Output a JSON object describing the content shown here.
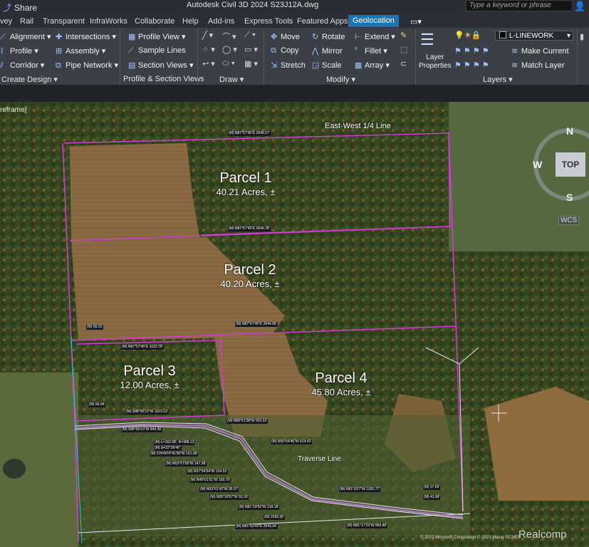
{
  "titlebar": {
    "share_label": "Share",
    "app_title": "Autodesk Civil 3D 2024    S23J12A.dwg",
    "search_placeholder": "Type a keyword or phrase"
  },
  "tabs": [
    "vey",
    "Rail",
    "Transparent",
    "InfraWorks",
    "Collaborate",
    "Help",
    "Add-ins",
    "Express Tools",
    "Featured Apps",
    "Geolocation"
  ],
  "active_tab": "Geolocation",
  "ribbon": {
    "create_design": {
      "items": [
        "Alignment",
        "Profile",
        "Corridor",
        "Intersections",
        "Assembly",
        "Pipe Network"
      ],
      "label": "Create Design"
    },
    "profile_section": {
      "items": [
        "Profile View",
        "Sample Lines",
        "Section Views"
      ],
      "label": "Profile & Section Views"
    },
    "draw": {
      "label": "Draw"
    },
    "modify": {
      "items": [
        "Move",
        "Copy",
        "Stretch",
        "Rotate",
        "Mirror",
        "Scale",
        "Extend",
        "Fillet",
        "Array"
      ],
      "label": "Modify"
    },
    "layers": {
      "layer_properties": "Layer\nProperties",
      "current_layer": "L-LINEWORK",
      "make_current": "Make Current",
      "match_layer": "Match Layer",
      "label": "Layers"
    }
  },
  "viewport": {
    "view_label": "reframe]",
    "compass": {
      "n": "N",
      "w": "W",
      "s": "S",
      "top": "TOP",
      "wcs": "WCS"
    },
    "parcels": [
      {
        "name": "Parcel 1",
        "acres": "40.21 Acres, ±"
      },
      {
        "name": "Parcel 2",
        "acres": "40.20 Acres, ±"
      },
      {
        "name": "Parcel 3",
        "acres": "12.00 Acres, ±"
      },
      {
        "name": "Parcel 4",
        "acres": "45.80 Acres, ±"
      }
    ],
    "labels": {
      "quarter_line": "East-West 1/4 Line",
      "traverse": "Traverse Line"
    },
    "bearings": [
      "(M) N87°57'45\"E 2645.57'",
      "(M) N87°57'45\"E 2646.78'",
      "(M) N87°57'45\"E 2644.99'",
      "(M) N87°57'45\"E 1022.78'",
      "(M) S88°50'23\"W 1023.19'",
      "(M) S88°50'23\"W 844.36'",
      "(M) N89°51'38\"W 952.62'",
      "(M) N50°54'46\"W 624.43'",
      "(M) N81°03'7\"W 1252.77'",
      "(M) N81°17'23\"W 866.80'",
      "(M) N81°52'43\"E 2643.34'",
      "(M) 2599.36'",
      "(M) 66.01'",
      "(M) 66.04'",
      "(M) 37.65'",
      "(M) 43.99'",
      "(M) L=162.68', R=388.13",
      "(M) Δ=22°26'46\"",
      "(M) CH=N74°41'56\"W 151.08'",
      "(M) N53°57'56\"W 147.38'",
      "(M) N37°54'54\"W 124.51'",
      "(M) N49°01'51\"W 100.70'",
      "(M) N53°01'42\"W 95.57'",
      "(M) N55°18'57\"W 93.26'",
      "(M) N81°19'52\"W 318.18'"
    ],
    "credit": "© 2023 Microsoft Corporation © 2023 Maxar ©CNES",
    "watermark": "Realcomp"
  },
  "colors": {
    "parcel_line": "#d23cd2",
    "traverse_line": "#e6e6f0",
    "active_tab": "#1b74b6"
  }
}
